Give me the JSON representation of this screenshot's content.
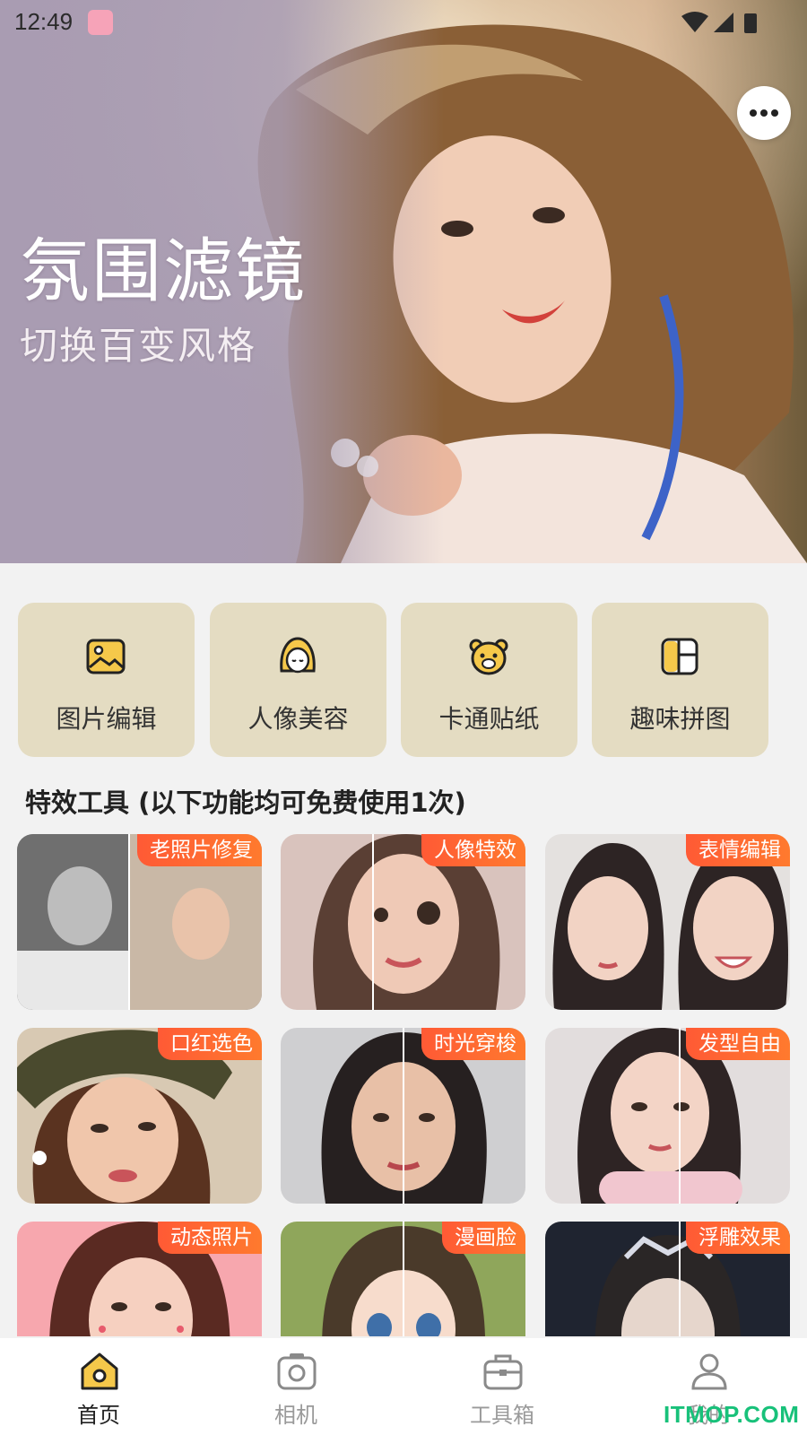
{
  "status_bar": {
    "time": "12:49",
    "icons": [
      "app-notification-icon",
      "wifi-icon",
      "signal-icon",
      "battery-icon"
    ]
  },
  "hero": {
    "title": "氛围滤镜",
    "subtitle": "切换百变风格",
    "more_icon": "more-dots-icon"
  },
  "categories": [
    {
      "label": "图片编辑",
      "icon": "image-edit-icon"
    },
    {
      "label": "人像美容",
      "icon": "portrait-beauty-icon"
    },
    {
      "label": "卡通贴纸",
      "icon": "cartoon-bear-icon"
    },
    {
      "label": "趣味拼图",
      "icon": "collage-icon"
    }
  ],
  "section_title": "特效工具 (以下功能均可免费使用1次)",
  "effects": [
    {
      "label": "老照片修复"
    },
    {
      "label": "人像特效"
    },
    {
      "label": "表情编辑"
    },
    {
      "label": "口红选色"
    },
    {
      "label": "时光穿梭"
    },
    {
      "label": "发型自由"
    },
    {
      "label": "动态照片"
    },
    {
      "label": "漫画脸"
    },
    {
      "label": "浮雕效果"
    }
  ],
  "bottom_nav": [
    {
      "label": "首页",
      "icon": "home-icon",
      "active": true
    },
    {
      "label": "相机",
      "icon": "camera-icon",
      "active": false
    },
    {
      "label": "工具箱",
      "icon": "toolbox-icon",
      "active": false
    },
    {
      "label": "我的",
      "icon": "profile-icon",
      "active": false
    }
  ],
  "watermark": "ITMOP.COM",
  "colors": {
    "accent_yellow": "#f5c84a",
    "card_bg": "#e4dcc2",
    "badge_orange": "#ff5a35",
    "hero_lavender": "#a99cb2"
  }
}
